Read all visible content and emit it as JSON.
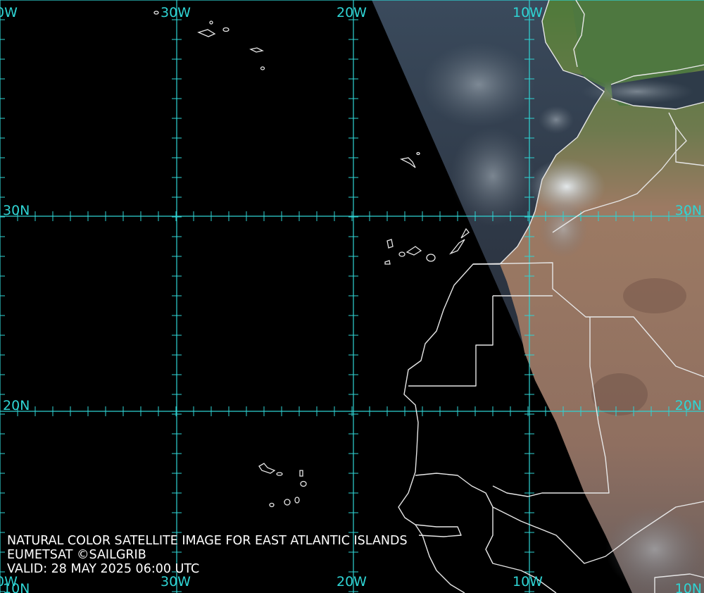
{
  "caption": {
    "line1": "NATURAL COLOR SATELLITE IMAGE FOR EAST ATLANTIC ISLANDS",
    "line2": "EUMETSAT ©SAILGRIB",
    "line3": "VALID:  28 MAY 2025 06:00 UTC"
  },
  "grid": {
    "lon_top": [
      "0W",
      "30W",
      "20W",
      "10W"
    ],
    "lon_bottom": [
      "0W",
      "30W",
      "20W",
      "10W"
    ],
    "lat_left": [
      "30N",
      "20N",
      "10N"
    ],
    "lat_right": [
      "30N",
      "20N",
      "10N"
    ]
  },
  "colors": {
    "grid": "#2fd4d4",
    "coastline": "#e6e6e6",
    "night": "#000000"
  }
}
